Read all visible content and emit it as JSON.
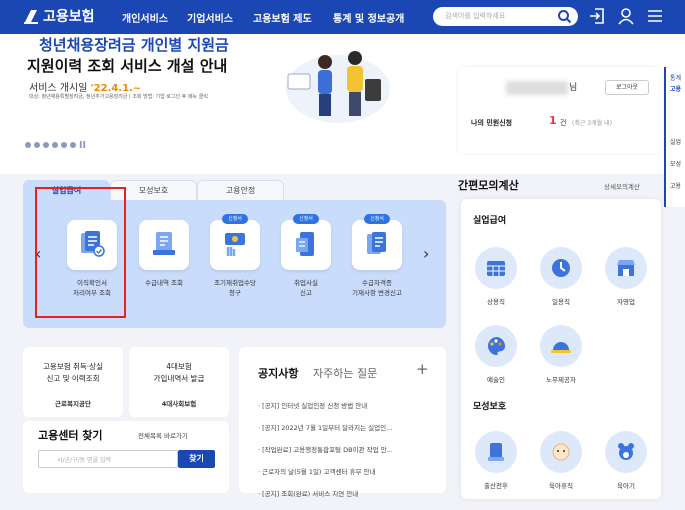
{
  "header": {
    "logo_text": "고용보험",
    "nav": [
      "개인서비스",
      "기업서비스",
      "고용보험 제도",
      "통계 및 정보공개"
    ],
    "search_placeholder": "검색어를 입력하세요"
  },
  "banner": {
    "line1": "청년채용장려금 개인별 지원금",
    "line2": "지원이력 조회 서비스 개설 안내",
    "line3_prefix": "서비스 개시일 ",
    "line3_date": "'22.4.1.~",
    "line4": "대상: 청년채용특별장려금, 청년추가고용장려금 | 조회 방법: 기업 로그인 후 메뉴 클릭"
  },
  "user": {
    "suffix": "님",
    "logout": "로그아웃",
    "my_request": "나의 민원신청",
    "count": "1",
    "count_unit": "건",
    "count_range": "(최근 3개월 내)"
  },
  "right_panel": {
    "items": [
      "통계",
      "고용",
      "실업",
      "모성",
      "고용"
    ]
  },
  "tabs": [
    "실업급여",
    "모성보호",
    "고용안정"
  ],
  "services": [
    {
      "label": "이직확인서\n처리여부 조회",
      "badge": ""
    },
    {
      "label": "수급내역 조회",
      "badge": ""
    },
    {
      "label": "조기재취업수당\n청구",
      "badge": "신청서"
    },
    {
      "label": "취업사실\n신고",
      "badge": "신청서"
    },
    {
      "label": "수급자격종\n기재사항 변경신고",
      "badge": "신청서"
    }
  ],
  "shortcut1": {
    "title": "고용보험 취득·상실\n신고 및 이력조회",
    "org": "근로복지공단"
  },
  "shortcut2": {
    "title": "4대보험\n가입내역서 발급",
    "org": "4대사회보험"
  },
  "find": {
    "title": "고용센터 찾기",
    "link": "전체목록 바로가기",
    "placeholder": "시/군/구/동 명을 입력",
    "button": "찾기"
  },
  "notice": {
    "tab1": "공지사항",
    "tab2": "자주하는 질문",
    "plus": "+",
    "items": [
      "· [공지] 인터넷 실업인정 신청 방법 안내",
      "· [공지] 2022년 7월 1일부터 달라지는 실업인...",
      "· [작업완료] 고용행정통합포털 DB이관 작업 안...",
      "· 근로자의 날(5월 1일) 고객센터 휴무 안내",
      "· [공지] 조회(완료) 서비스 지연 안내"
    ]
  },
  "calc": {
    "title": "간편모의계산",
    "link": "상세모의계산",
    "section1": "실업급여",
    "row1": [
      "상용직",
      "일용직",
      "자영업"
    ],
    "row2": [
      "예술인",
      "노무제공자"
    ],
    "section2": "모성보호",
    "row3": [
      "출산전후",
      "육아휴직",
      "육아기"
    ]
  },
  "colors": {
    "primary": "#1b47b5",
    "panel": "#c9dcfb",
    "badge": "#2d73e4",
    "highlight": "#e42222"
  }
}
